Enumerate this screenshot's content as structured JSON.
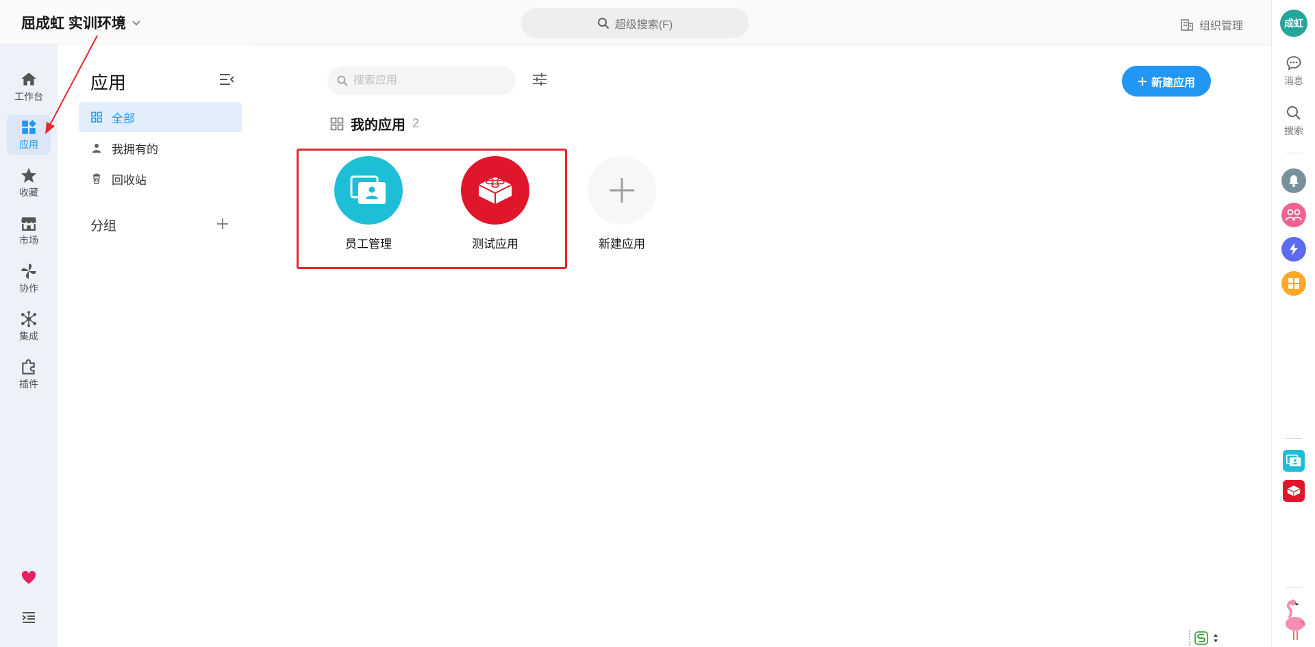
{
  "header": {
    "org_name": "屈成虹 实训环境",
    "search_label": "超级搜索(F)",
    "org_manage_label": "组织管理"
  },
  "leftnav": {
    "items": [
      {
        "label": "工作台",
        "icon": "home-icon"
      },
      {
        "label": "应用",
        "icon": "apps-icon",
        "active": true
      },
      {
        "label": "收藏",
        "icon": "star-icon"
      },
      {
        "label": "市场",
        "icon": "store-icon"
      },
      {
        "label": "协作",
        "icon": "pinwheel-icon"
      },
      {
        "label": "集成",
        "icon": "network-icon"
      },
      {
        "label": "插件",
        "icon": "plugin-icon"
      }
    ],
    "bottom_icons": [
      "heart-icon",
      "expand-menu-icon"
    ]
  },
  "sidepanel": {
    "title": "应用",
    "items": [
      {
        "label": "全部",
        "icon": "grid-icon",
        "active": true
      },
      {
        "label": "我拥有的",
        "icon": "person-icon"
      },
      {
        "label": "回收站",
        "icon": "trash-icon"
      }
    ],
    "group_title": "分组"
  },
  "main": {
    "search_placeholder": "搜索应用",
    "new_app_button": "新建应用",
    "section_title": "我的应用",
    "section_count": "2",
    "apps": [
      {
        "name": "员工管理",
        "color": "#1ebfd6",
        "icon": "employee-card-icon"
      },
      {
        "name": "测试应用",
        "color": "#e0162b",
        "icon": "brick-icon"
      }
    ],
    "new_app_card_label": "新建应用"
  },
  "rightbar": {
    "avatar_text": "成虹",
    "message_label": "消息",
    "search_label": "搜索",
    "circles": [
      {
        "icon": "bell-icon",
        "color": "#78909c"
      },
      {
        "icon": "team-icon",
        "color": "#f06292"
      },
      {
        "icon": "flash-icon",
        "color": "#5c6bf0"
      },
      {
        "icon": "grid-app-icon",
        "color": "#ffa726"
      }
    ],
    "pinned_apps": [
      {
        "icon": "employee-card-icon",
        "color": "#1ebfd6"
      },
      {
        "icon": "brick-icon",
        "color": "#e0162b"
      }
    ]
  },
  "colors": {
    "primary": "#2196f3",
    "highlight": "#e5282a",
    "nav_bg": "#eef2f8"
  }
}
